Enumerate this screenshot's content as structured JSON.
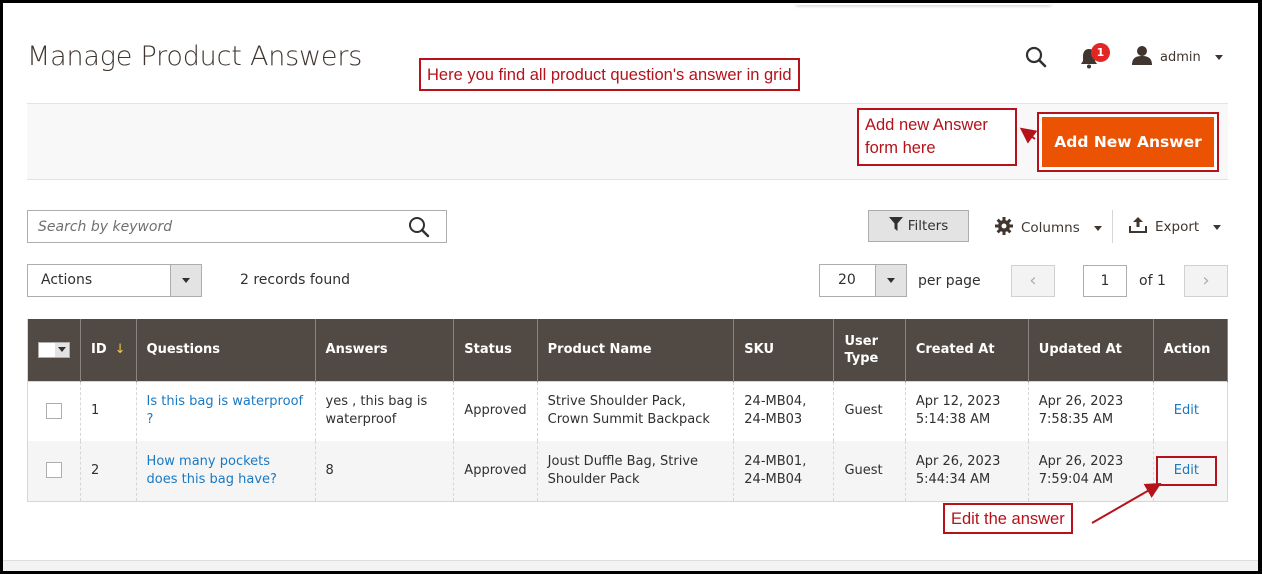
{
  "header": {
    "title": "Manage Product Answers",
    "notifications_count": "1",
    "user_name": "admin"
  },
  "annotations": {
    "grid_note": "Here you find all product question's answer in grid",
    "add_note_line1": "Add new Answer",
    "add_note_line2": "form here",
    "edit_note": "Edit the answer",
    "color": "#b5121b"
  },
  "toolbar": {
    "add_button_label": "Add New Answer",
    "add_button_color": "#eb5202",
    "search_placeholder": "Search by keyword",
    "filters_label": "Filters",
    "columns_label": "Columns",
    "export_label": "Export",
    "actions_label": "Actions",
    "records_found": "2 records found",
    "per_page_value": "20",
    "per_page_label": "per page",
    "current_page": "1",
    "total_pages_label": "of 1"
  },
  "grid": {
    "columns": [
      "ID",
      "Questions",
      "Answers",
      "Status",
      "Product Name",
      "SKU",
      "User Type",
      "Created At",
      "Updated At",
      "Action"
    ],
    "rows": [
      {
        "id": "1",
        "question": "Is this bag is waterproof ?",
        "answer": "yes , this bag is waterproof",
        "status": "Approved",
        "product_name": "Strive Shoulder Pack, Crown Summit Backpack",
        "sku": "24-MB04, 24-MB03",
        "user_type": "Guest",
        "created_at_date": "Apr 12, 2023",
        "created_at_time": "5:14:38 AM",
        "updated_at_date": "Apr 26, 2023",
        "updated_at_time": "7:58:35 AM",
        "action": "Edit"
      },
      {
        "id": "2",
        "question": "How many pockets does this bag have?",
        "answer": "8",
        "status": "Approved",
        "product_name": "Joust Duffle Bag, Strive Shoulder Pack",
        "sku": "24-MB01, 24-MB04",
        "user_type": "Guest",
        "created_at_date": "Apr 26, 2023",
        "created_at_time": "5:44:34 AM",
        "updated_at_date": "Apr 26, 2023",
        "updated_at_time": "7:59:04 AM",
        "action": "Edit"
      }
    ]
  }
}
